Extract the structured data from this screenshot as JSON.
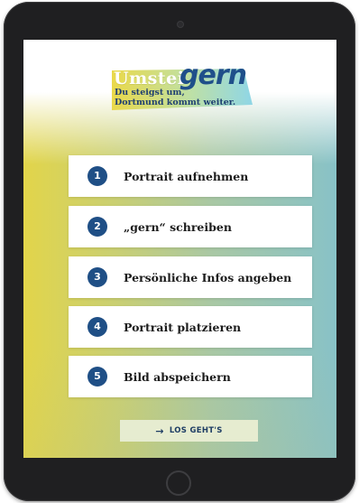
{
  "logo": {
    "word_part1": "Umstei",
    "word_part2": "gern",
    "tagline_line1": "Du steigst um,",
    "tagline_line2": "Dortmund kommt weiter."
  },
  "steps": [
    {
      "number": "1",
      "label": "Portrait aufnehmen"
    },
    {
      "number": "2",
      "label": "„gern“ schreiben"
    },
    {
      "number": "3",
      "label": "Persönliche Infos angeben"
    },
    {
      "number": "4",
      "label": "Portrait platzieren"
    },
    {
      "number": "5",
      "label": "Bild abspeichern"
    }
  ],
  "cta": {
    "label": "LOS GEHT'S",
    "icon": "arrow-right-icon"
  },
  "colors": {
    "accent_blue": "#1f4f86",
    "logo_cyan": "#8fd6e6",
    "gradient_left": "#e2d54a",
    "gradient_right": "#88c2c7",
    "device_bezel": "#1f1f21"
  }
}
